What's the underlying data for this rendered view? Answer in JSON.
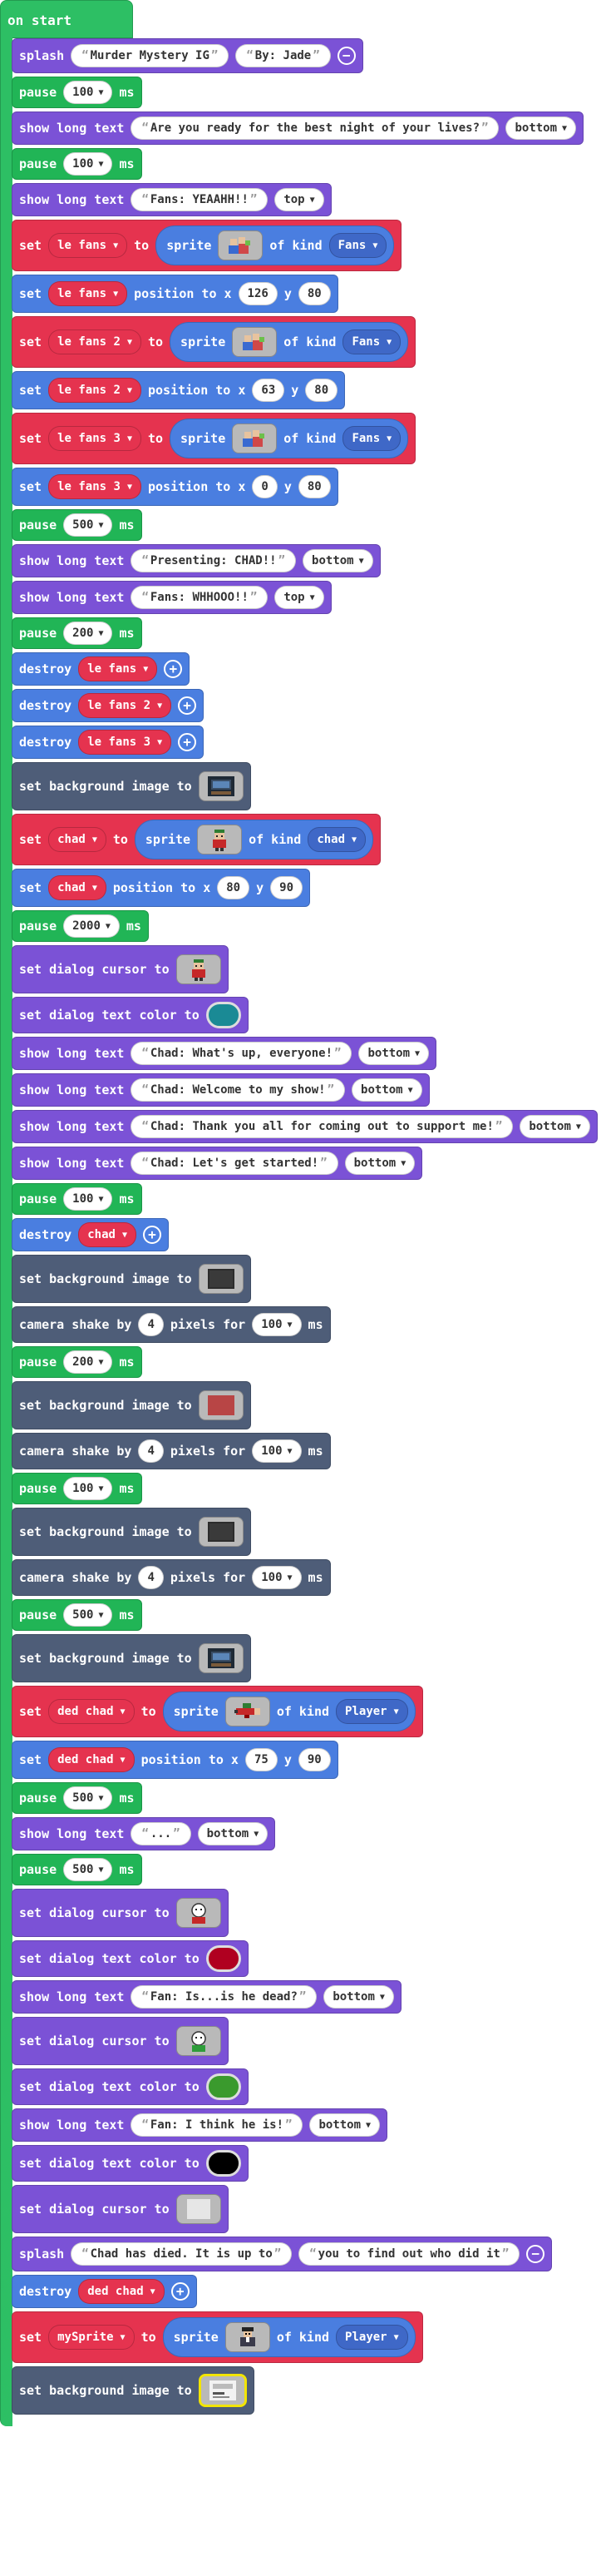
{
  "colors": {
    "event": "#2dbf64",
    "game": "#7b52d6",
    "loops": "#21b556",
    "sprites": "#4a7ee0",
    "variables": "#e5334f",
    "scene": "#4e5d78",
    "kind": "#3f68c7",
    "dialog_red": "#b00020",
    "dialog_teal": "#1a8a95",
    "dialog_green": "#3a9a2d",
    "dialog_black": "#000000"
  },
  "hat": {
    "label": "on start"
  },
  "blocks": [
    {
      "type": "splash",
      "label": "splash",
      "text1": "Murder Mystery IG",
      "text2": "By: Jade"
    },
    {
      "type": "pause",
      "label": "pause",
      "value": "100",
      "unit": "ms"
    },
    {
      "type": "longtext",
      "label": "show long text",
      "text": "Are you ready for the best night of your lives?",
      "position": "bottom"
    },
    {
      "type": "pause",
      "label": "pause",
      "value": "100",
      "unit": "ms"
    },
    {
      "type": "longtext",
      "label": "show long text",
      "text": "Fans: YEAAHH!!",
      "position": "top"
    },
    {
      "type": "setsprite",
      "label_set": "set",
      "var": "le fans",
      "label_to": "to",
      "label_sprite": "sprite",
      "label_kind": "of kind",
      "kind": "Fans",
      "icon": "fans-sprite-icon"
    },
    {
      "type": "position",
      "label_set": "set",
      "var": "le fans",
      "label_pos": "position to x",
      "x": "126",
      "label_y": "y",
      "y": "80"
    },
    {
      "type": "setsprite",
      "label_set": "set",
      "var": "le fans 2",
      "label_to": "to",
      "label_sprite": "sprite",
      "label_kind": "of kind",
      "kind": "Fans",
      "icon": "fans-sprite-icon"
    },
    {
      "type": "position",
      "label_set": "set",
      "var": "le fans 2",
      "label_pos": "position to x",
      "x": "63",
      "label_y": "y",
      "y": "80"
    },
    {
      "type": "setsprite",
      "label_set": "set",
      "var": "le fans 3",
      "label_to": "to",
      "label_sprite": "sprite",
      "label_kind": "of kind",
      "kind": "Fans",
      "icon": "fans-sprite-icon"
    },
    {
      "type": "position",
      "label_set": "set",
      "var": "le fans 3",
      "label_pos": "position to x",
      "x": "0",
      "label_y": "y",
      "y": "80"
    },
    {
      "type": "pause",
      "label": "pause",
      "value": "500",
      "unit": "ms"
    },
    {
      "type": "longtext",
      "label": "show long text",
      "text": "Presenting: CHAD!!",
      "position": "bottom"
    },
    {
      "type": "longtext",
      "label": "show long text",
      "text": "Fans: WHHOOO!!",
      "position": "top"
    },
    {
      "type": "pause",
      "label": "pause",
      "value": "200",
      "unit": "ms"
    },
    {
      "type": "destroy",
      "label": "destroy",
      "var": "le fans"
    },
    {
      "type": "destroy",
      "label": "destroy",
      "var": "le fans 2"
    },
    {
      "type": "destroy",
      "label": "destroy",
      "var": "le fans 3"
    },
    {
      "type": "bgimage",
      "label": "set background image to",
      "icon": "stage-background-icon"
    },
    {
      "type": "setsprite",
      "label_set": "set",
      "var": "chad",
      "label_to": "to",
      "label_sprite": "sprite",
      "label_kind": "of kind",
      "kind": "chad",
      "icon": "chad-sprite-icon"
    },
    {
      "type": "position",
      "label_set": "set",
      "var": "chad",
      "label_pos": "position to x",
      "x": "80",
      "label_y": "y",
      "y": "90"
    },
    {
      "type": "pause",
      "label": "pause",
      "value": "2000",
      "unit": "ms"
    },
    {
      "type": "cursor",
      "label": "set dialog cursor to",
      "icon": "chad-cursor-icon"
    },
    {
      "type": "textcolor",
      "label": "set dialog text color to",
      "color": "#1a8a95"
    },
    {
      "type": "longtext",
      "label": "show long text",
      "text": "Chad: What's up, everyone!",
      "position": "bottom"
    },
    {
      "type": "longtext",
      "label": "show long text",
      "text": "Chad: Welcome to my show!",
      "position": "bottom"
    },
    {
      "type": "longtext",
      "label": "show long text",
      "text": "Chad: Thank you all for coming out to support me!",
      "position": "bottom"
    },
    {
      "type": "longtext",
      "label": "show long text",
      "text": "Chad: Let's get started!",
      "position": "bottom"
    },
    {
      "type": "pause",
      "label": "pause",
      "value": "100",
      "unit": "ms"
    },
    {
      "type": "destroy",
      "label": "destroy",
      "var": "chad"
    },
    {
      "type": "bgimage",
      "label": "set background image to",
      "icon": "dark-background-icon"
    },
    {
      "type": "shake",
      "label": "camera shake by",
      "value": "4",
      "label_mid": "pixels for",
      "dur": "100",
      "unit": "ms"
    },
    {
      "type": "pause",
      "label": "pause",
      "value": "200",
      "unit": "ms"
    },
    {
      "type": "bgimage",
      "label": "set background image to",
      "icon": "red-background-icon"
    },
    {
      "type": "shake",
      "label": "camera shake by",
      "value": "4",
      "label_mid": "pixels for",
      "dur": "100",
      "unit": "ms"
    },
    {
      "type": "pause",
      "label": "pause",
      "value": "100",
      "unit": "ms"
    },
    {
      "type": "bgimage",
      "label": "set background image to",
      "icon": "dark-background-icon"
    },
    {
      "type": "shake",
      "label": "camera shake by",
      "value": "4",
      "label_mid": "pixels for",
      "dur": "100",
      "unit": "ms"
    },
    {
      "type": "pause",
      "label": "pause",
      "value": "500",
      "unit": "ms"
    },
    {
      "type": "bgimage",
      "label": "set background image to",
      "icon": "stage-background-icon"
    },
    {
      "type": "setsprite",
      "label_set": "set",
      "var": "ded chad",
      "label_to": "to",
      "label_sprite": "sprite",
      "label_kind": "of kind",
      "kind": "Player",
      "icon": "dead-chad-sprite-icon"
    },
    {
      "type": "position",
      "label_set": "set",
      "var": "ded chad",
      "label_pos": "position to x",
      "x": "75",
      "label_y": "y",
      "y": "90"
    },
    {
      "type": "pause",
      "label": "pause",
      "value": "500",
      "unit": "ms"
    },
    {
      "type": "longtext",
      "label": "show long text",
      "text": "...",
      "position": "bottom"
    },
    {
      "type": "pause",
      "label": "pause",
      "value": "500",
      "unit": "ms"
    },
    {
      "type": "cursor",
      "label": "set dialog cursor to",
      "icon": "fan-red-cursor-icon"
    },
    {
      "type": "textcolor",
      "label": "set dialog text color to",
      "color": "#b00020"
    },
    {
      "type": "longtext",
      "label": "show long text",
      "text": "Fan: Is...is he dead?",
      "position": "bottom"
    },
    {
      "type": "cursor",
      "label": "set dialog cursor to",
      "icon": "fan-green-cursor-icon"
    },
    {
      "type": "textcolor",
      "label": "set dialog text color to",
      "color": "#3a9a2d"
    },
    {
      "type": "longtext",
      "label": "show long text",
      "text": "Fan: I think he is!",
      "position": "bottom"
    },
    {
      "type": "textcolor",
      "label": "set dialog text color to",
      "color": "#000000"
    },
    {
      "type": "cursor",
      "label": "set dialog cursor to",
      "icon": "blank-cursor-icon"
    },
    {
      "type": "splash",
      "label": "splash",
      "text1": "Chad has died. It is up to",
      "text2": "you to find out who did it"
    },
    {
      "type": "destroy",
      "label": "destroy",
      "var": "ded chad"
    },
    {
      "type": "setsprite",
      "label_set": "set",
      "var": "mySprite",
      "label_to": "to",
      "label_sprite": "sprite",
      "label_kind": "of kind",
      "kind": "Player",
      "icon": "detective-sprite-icon"
    },
    {
      "type": "bgimage",
      "label": "set background image to",
      "icon": "final-background-icon",
      "selected": true
    }
  ]
}
